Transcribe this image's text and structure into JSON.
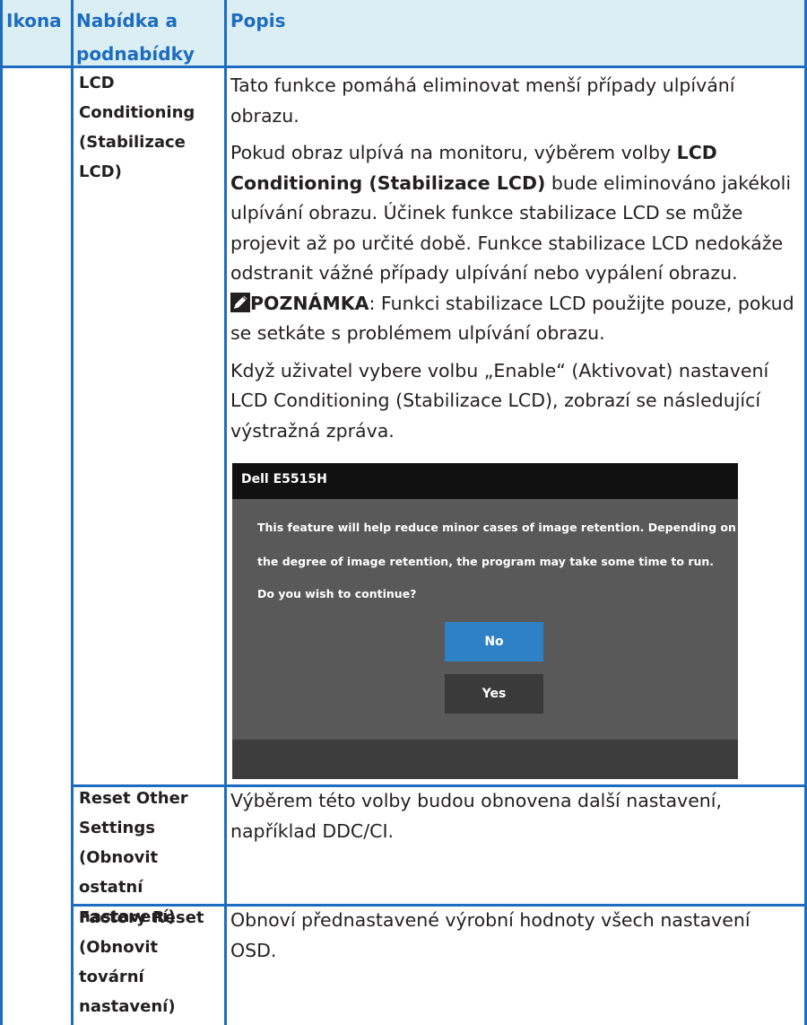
{
  "table": {
    "headers": {
      "icon": "Ikona",
      "menu_line1": "Nabídka a",
      "menu_line2": "podnabídky",
      "desc": "Popis"
    },
    "rows": [
      {
        "menu_lines": [
          "LCD",
          "Conditioning",
          "(Stabilizace",
          "LCD)"
        ],
        "desc": {
          "p1": "Tato funkce pomáhá eliminovat menší případy ulpívání obrazu.",
          "p2_before": "Pokud obraz ulpívá na monitoru, výběrem volby ",
          "p2_bold": "LCD Conditioning (Stabilizace LCD)",
          "p2_after": " bude eliminováno jakékoli ulpívání obrazu. Účinek funkce stabilizace LCD se může projevit až po určité době. Funkce stabilizace LCD nedokáže odstranit vážné případy ulpívání nebo vypálení obrazu.",
          "note_label": "POZNÁMKA",
          "note_text": ": Funkci stabilizace LCD použijte pouze, pokud se setkáte s problémem ulpívání obrazu.",
          "p3": "Když uživatel vybere volbu „Enable“ (Aktivovat) nastavení LCD Conditioning (Stabilizace LCD), zobrazí se následující výstražná zpráva."
        }
      },
      {
        "menu_lines": [
          "Reset Other",
          "Settings",
          "(Obnovit",
          "ostatní",
          "nastavení)"
        ],
        "desc": "Výběrem této volby budou obnovena další nastavení, například DDC/CI."
      },
      {
        "menu_lines": [
          "Factory Reset",
          "(Obnovit",
          "tovární",
          "nastavení)"
        ],
        "desc": "Obnoví přednastavené výrobní hodnoty všech nastavení OSD."
      }
    ]
  },
  "dialog": {
    "title": "Dell E5515H",
    "line1": "This feature will help reduce minor cases of image retention. Depending on",
    "line2": "the degree of image retention, the program may take some time to run.",
    "line3": "Do you wish to continue?",
    "no_label": "No",
    "yes_label": "Yes"
  },
  "colors": {
    "header_bg": "#dbeef4",
    "rule": "#1c6cc0",
    "header_text": "#1c6cc0",
    "no_button": "#2f81c5"
  },
  "icons": {
    "note": "pencil-note-icon"
  }
}
